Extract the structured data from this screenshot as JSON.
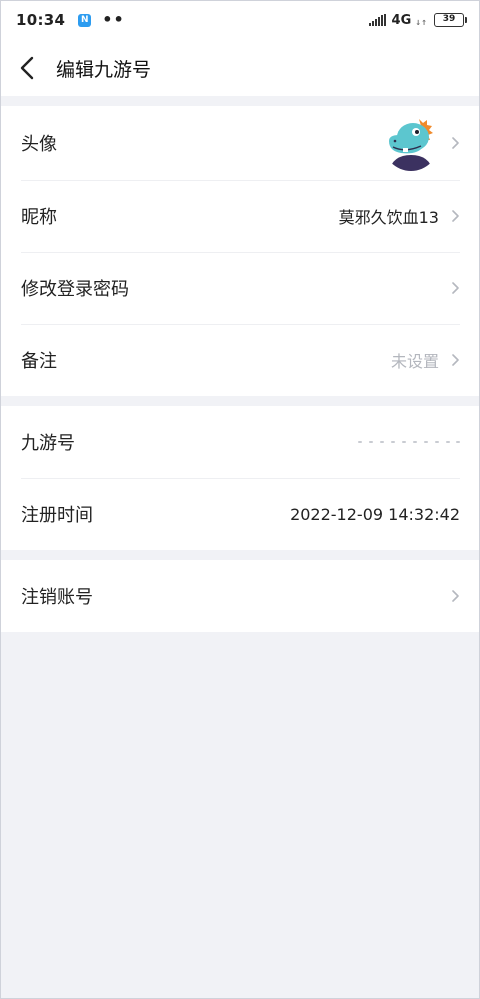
{
  "status_bar": {
    "time": "10:34",
    "notification_icon": "N",
    "dots": "••",
    "network": "4G",
    "battery": "39"
  },
  "header": {
    "title": "编辑九游号"
  },
  "profile": {
    "avatar_label": "头像",
    "nickname_label": "昵称",
    "nickname_value": "莫邪久饮血13",
    "password_label": "修改登录密码",
    "remark_label": "备注",
    "remark_value": "未设置"
  },
  "account": {
    "id_label": "九游号",
    "register_label": "注册时间",
    "register_value": "2022-12-09 14:32:42"
  },
  "danger": {
    "cancel_label": "注销账号"
  },
  "icons": {
    "back": "chevron-left-icon",
    "row_arrow": "chevron-right-icon",
    "avatar": "dinosaur-avatar"
  }
}
